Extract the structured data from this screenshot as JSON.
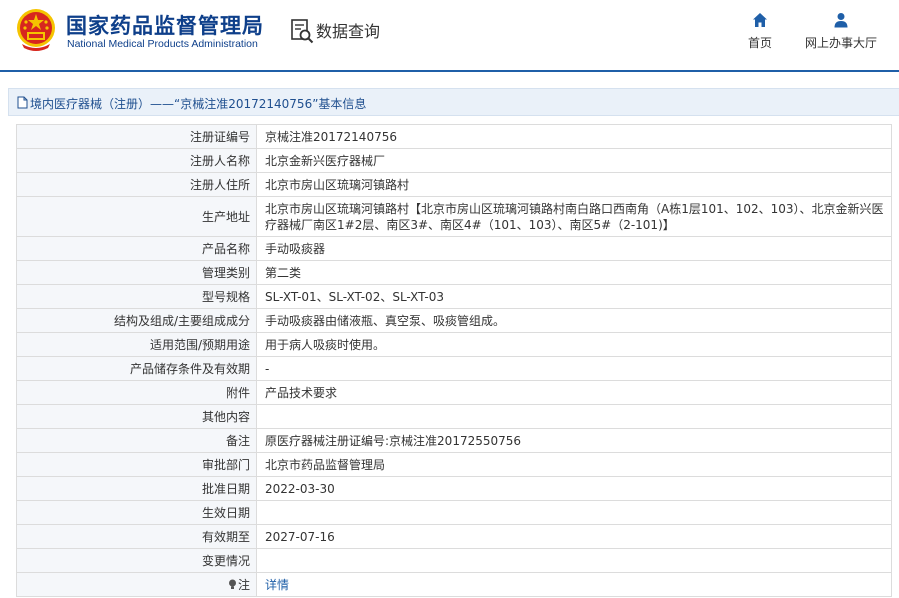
{
  "header": {
    "title_cn": "国家药品监督管理局",
    "title_en": "National Medical Products Administration",
    "query_title": "数据查询",
    "nav": [
      {
        "label": "首页",
        "icon": "home-icon"
      },
      {
        "label": "网上办事大厅",
        "icon": "user-icon"
      }
    ]
  },
  "breadcrumb": {
    "text": "境内医疗器械（注册）——“京械注准20172140756”基本信息"
  },
  "fields": [
    {
      "label": "注册证编号",
      "value": "京械注准20172140756"
    },
    {
      "label": "注册人名称",
      "value": "北京金新兴医疗器械厂"
    },
    {
      "label": "注册人住所",
      "value": "北京市房山区琉璃河镇路村"
    },
    {
      "label": "生产地址",
      "value": "北京市房山区琉璃河镇路村【北京市房山区琉璃河镇路村南白路口西南角（A栋1层101、102、103）、北京金新兴医疗器械厂南区1#2层、南区3#、南区4#（101、103）、南区5#（2-101)】"
    },
    {
      "label": "产品名称",
      "value": "手动吸痰器"
    },
    {
      "label": "管理类别",
      "value": "第二类"
    },
    {
      "label": "型号规格",
      "value": "SL-XT-01、SL-XT-02、SL-XT-03"
    },
    {
      "label": "结构及组成/主要组成成分",
      "value": "手动吸痰器由储液瓶、真空泵、吸痰管组成。"
    },
    {
      "label": "适用范围/预期用途",
      "value": "用于病人吸痰时使用。"
    },
    {
      "label": "产品储存条件及有效期",
      "value": "-"
    },
    {
      "label": "附件",
      "value": "产品技术要求"
    },
    {
      "label": "其他内容",
      "value": ""
    },
    {
      "label": "备注",
      "value": "原医疗器械注册证编号:京械注准20172550756"
    },
    {
      "label": "审批部门",
      "value": "北京市药品监督管理局"
    },
    {
      "label": "批准日期",
      "value": "2022-03-30"
    },
    {
      "label": "生效日期",
      "value": ""
    },
    {
      "label": "有效期至",
      "value": "2027-07-16"
    },
    {
      "label": "变更情况",
      "value": ""
    },
    {
      "label": "注",
      "value": "详情"
    }
  ],
  "colors": {
    "brand_blue": "#0e3f8a",
    "emblem_red": "#d7261e",
    "emblem_gold": "#f5c400",
    "link_blue": "#1f5fa8"
  }
}
